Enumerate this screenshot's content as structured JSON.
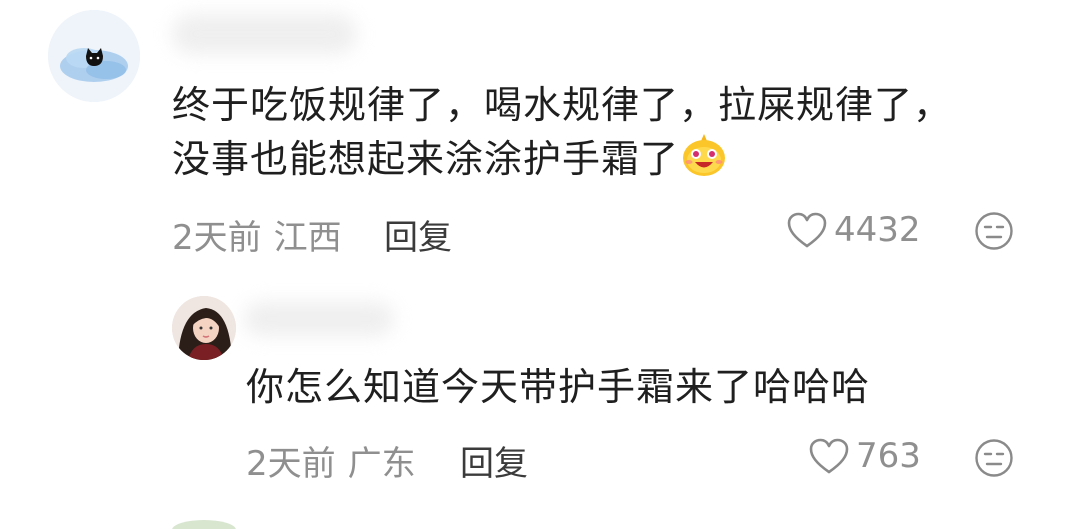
{
  "comments": [
    {
      "text_line1": "终于吃饭规律了，喝水规律了，拉屎规律了，",
      "text_line2": "没事也能想起来涂涂护手霜了",
      "time": "2天前",
      "location": "江西",
      "reply_label": "回复",
      "likes": "4432",
      "emoji_icon": "smiling-face-emoji"
    },
    {
      "text_line1": "你怎么知道今天带护手霜来了哈哈哈",
      "time": "2天前",
      "location": "广东",
      "reply_label": "回复",
      "likes": "763"
    }
  ],
  "colors": {
    "text": "#1f1f1f",
    "meta": "#8f8f8f",
    "reply": "#3b3b3b",
    "icon": "#8a8a8a"
  }
}
